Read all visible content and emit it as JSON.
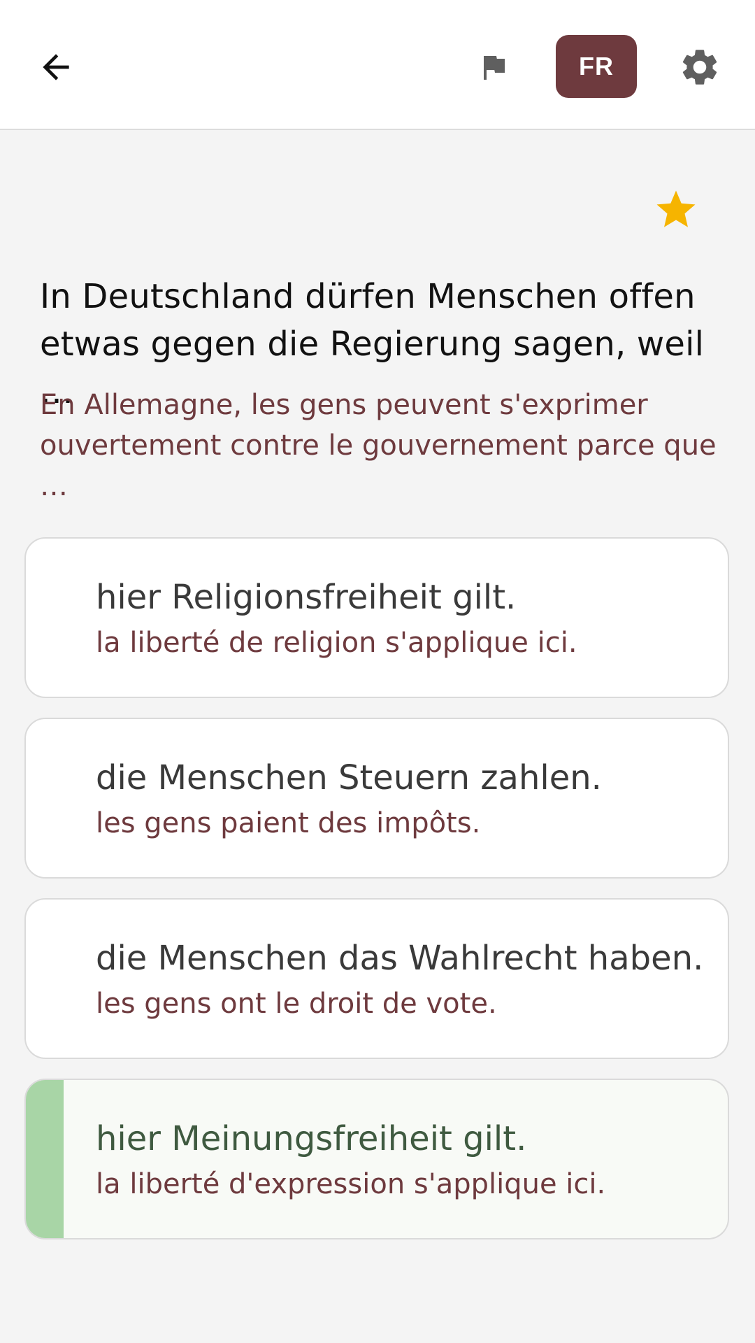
{
  "colors": {
    "accent": "#6e3a3e",
    "translation_text": "#6e3a3e",
    "star": "#f6b400",
    "icon": "#5f5f5f",
    "correct_bar": "#a8d5a6"
  },
  "header": {
    "back_icon": "arrow-left-icon",
    "flag_icon": "flag-icon",
    "language_label": "FR",
    "settings_icon": "gear-icon"
  },
  "question": {
    "favorite_icon": "star-icon",
    "text": "In Deutschland dürfen Menschen offen etwas gegen die Regierung sagen, weil …",
    "translation": "En Allemagne, les gens peuvent s'exprimer ouvertement contre le gouvernement parce que …"
  },
  "answers": [
    {
      "text": "hier Religionsfreiheit gilt.",
      "translation": "la liberté de religion s'applique ici.",
      "correct": false
    },
    {
      "text": "die Menschen Steuern zahlen.",
      "translation": "les gens paient des impôts.",
      "correct": false
    },
    {
      "text": "die Menschen das Wahlrecht haben.",
      "translation": "les gens ont le droit de vote.",
      "correct": false
    },
    {
      "text": "hier Meinungsfreiheit gilt.",
      "translation": "la liberté d'expression s'applique ici.",
      "correct": true
    }
  ]
}
